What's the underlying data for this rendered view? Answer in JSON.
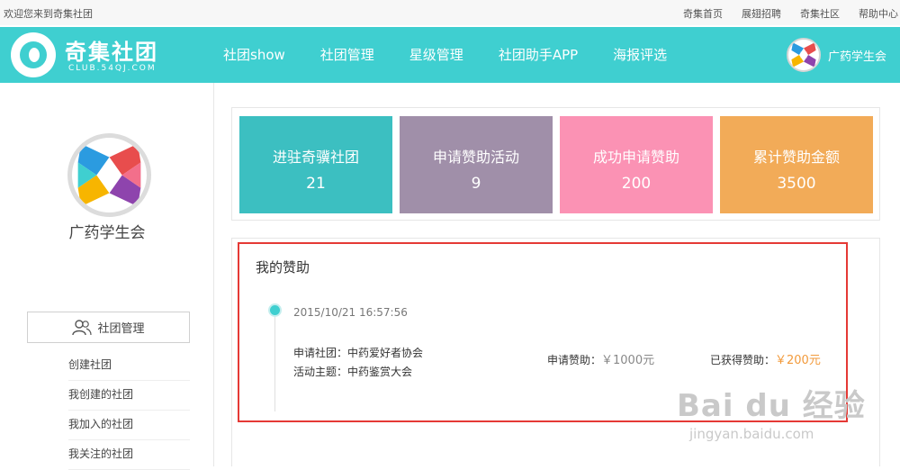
{
  "topbar": {
    "welcome": "欢迎您来到奇集社团",
    "links": [
      "奇集首页",
      "展翅招聘",
      "奇集社区",
      "帮助中心"
    ]
  },
  "header": {
    "logo_title": "奇集社团",
    "logo_sub": "CLUB.54QJ.COM",
    "nav": [
      "社团show",
      "社团管理",
      "星级管理",
      "社团助手APP",
      "海报评选"
    ],
    "user_name": "广药学生会"
  },
  "sidebar": {
    "org_name": "广药学生会",
    "menu_title": "社团管理",
    "menu_items": [
      "创建社团",
      "我创建的社团",
      "我加入的社团",
      "我关注的社团"
    ]
  },
  "stats": [
    {
      "title": "进驻奇骥社团",
      "value": "21",
      "color": "#3cbfc1"
    },
    {
      "title": "申请赞助活动",
      "value": "9",
      "color": "#a08fa9"
    },
    {
      "title": "成功申请赞助",
      "value": "200",
      "color": "#fb92b4"
    },
    {
      "title": "累计赞助金额",
      "value": "3500",
      "color": "#f2ab58"
    }
  ],
  "sponsor": {
    "heading": "我的赞助",
    "time": "2015/10/21 16:57:56",
    "club_line": "申请社团：中药爱好者协会",
    "topic_line": "活动主题：中药鉴赏大会",
    "apply_label": "申请赞助：",
    "apply_amount": "￥1000元",
    "got_label": "已获得赞助：",
    "got_amount": "￥200元"
  },
  "watermark": {
    "brand": "Bai du 经验",
    "url": "jingyan.baidu.com"
  },
  "colors": {
    "header": "#3fcfd0",
    "highlight": "#e53935"
  }
}
